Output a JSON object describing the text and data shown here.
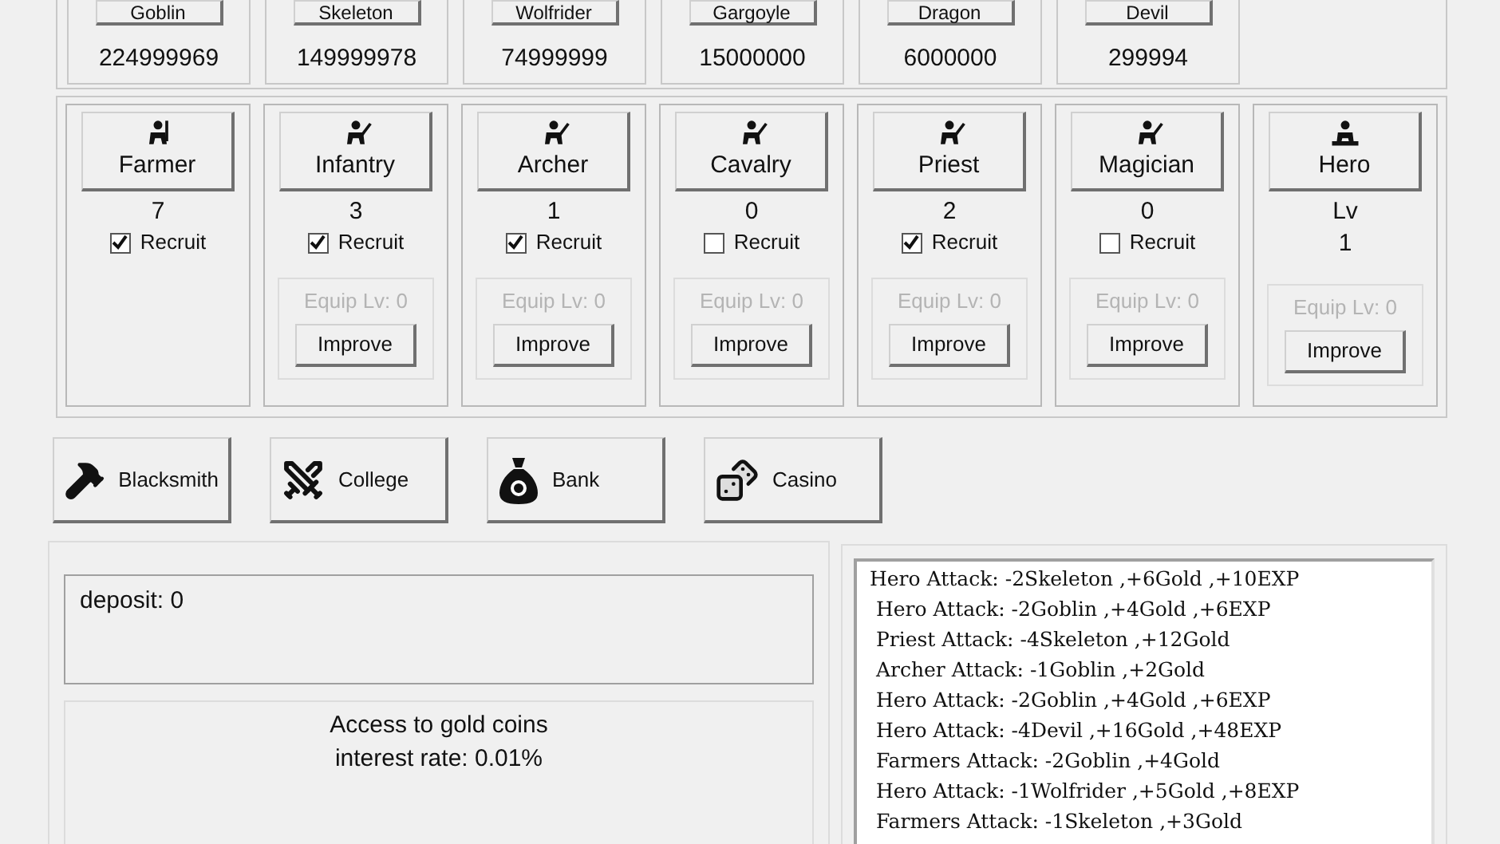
{
  "monsters": [
    {
      "name": "Goblin",
      "count": "224999969"
    },
    {
      "name": "Skeleton",
      "count": "149999978"
    },
    {
      "name": "Wolfrider",
      "count": "74999999"
    },
    {
      "name": "Gargoyle",
      "count": "15000000"
    },
    {
      "name": "Dragon",
      "count": "6000000"
    },
    {
      "name": "Devil",
      "count": "299994"
    }
  ],
  "units": [
    {
      "kind": "farmer",
      "name": "Farmer",
      "count": "7",
      "recruit_label": "Recruit",
      "checked": true
    },
    {
      "kind": "unit",
      "name": "Infantry",
      "count": "3",
      "recruit_label": "Recruit",
      "checked": true,
      "equip": "Equip Lv: 0",
      "improve": "Improve"
    },
    {
      "kind": "unit",
      "name": "Archer",
      "count": "1",
      "recruit_label": "Recruit",
      "checked": true,
      "equip": "Equip Lv: 0",
      "improve": "Improve"
    },
    {
      "kind": "unit",
      "name": "Cavalry",
      "count": "0",
      "recruit_label": "Recruit",
      "checked": false,
      "equip": "Equip Lv: 0",
      "improve": "Improve"
    },
    {
      "kind": "unit",
      "name": "Priest",
      "count": "2",
      "recruit_label": "Recruit",
      "checked": true,
      "equip": "Equip Lv: 0",
      "improve": "Improve"
    },
    {
      "kind": "unit",
      "name": "Magician",
      "count": "0",
      "recruit_label": "Recruit",
      "checked": false,
      "equip": "Equip Lv: 0",
      "improve": "Improve"
    },
    {
      "kind": "hero",
      "name": "Hero",
      "level_label": "Lv",
      "level": "1",
      "equip": "Equip Lv: 0",
      "improve": "Improve"
    }
  ],
  "buildings": [
    {
      "kind": "blacksmith",
      "label": "Blacksmith"
    },
    {
      "kind": "college",
      "label": "College"
    },
    {
      "kind": "bank",
      "label": "Bank"
    },
    {
      "kind": "casino",
      "label": "Casino"
    }
  ],
  "bank": {
    "deposit": "deposit:  0",
    "title": "Access to gold coins",
    "rate": "interest rate:  0.01%"
  },
  "log": [
    "Hero Attack: -2Skeleton ,+6Gold ,+10EXP",
    " Hero Attack: -2Goblin ,+4Gold ,+6EXP",
    " Priest Attack: -4Skeleton ,+12Gold",
    " Archer Attack: -1Goblin ,+2Gold",
    " Hero Attack: -2Goblin ,+4Gold ,+6EXP",
    " Hero Attack: -4Devil ,+16Gold ,+48EXP",
    " Farmers Attack: -2Goblin ,+4Gold",
    " Hero Attack: -1Wolfrider ,+5Gold ,+8EXP",
    " Farmers Attack: -1Skeleton ,+3Gold"
  ]
}
